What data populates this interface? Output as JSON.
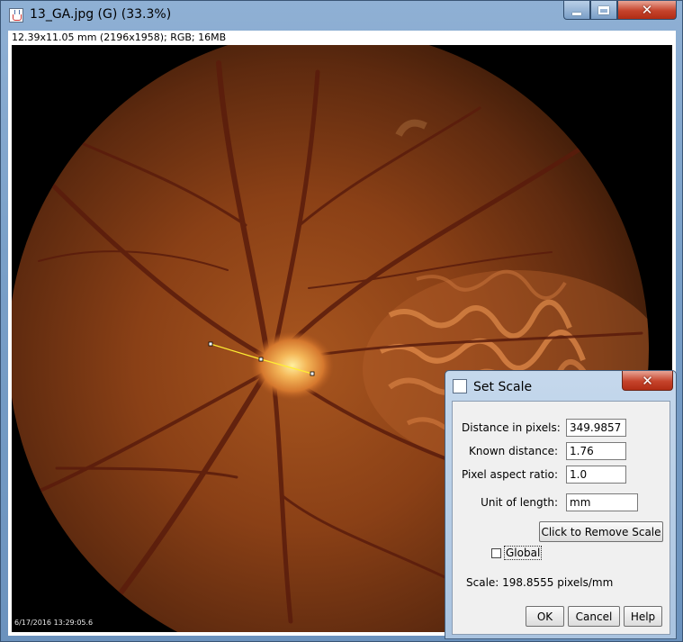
{
  "window": {
    "title": "13_GA.jpg (G) (33.3%)",
    "controls": {
      "minimize": "minimize-icon",
      "maximize": "maximize-icon",
      "close": "close-icon"
    }
  },
  "image": {
    "info": "12.39x11.05 mm (2196x1958); RGB; 16MB",
    "timestamp": "6/17/2016  13:29:05.6"
  },
  "dialog": {
    "title": "Set Scale",
    "fields": [
      {
        "label": "Distance in pixels:",
        "value": "349.9857"
      },
      {
        "label": "Known distance:",
        "value": "1.76"
      },
      {
        "label": "Pixel aspect ratio:",
        "value": "1.0"
      },
      {
        "label": "Unit of length:",
        "value": "mm"
      }
    ],
    "remove_scale_label": "Click to Remove Scale",
    "global_label": "Global",
    "global_checked": false,
    "scale_text": "Scale: 198.8555 pixels/mm",
    "buttons": {
      "ok": "OK",
      "cancel": "Cancel",
      "help": "Help"
    }
  },
  "colors": {
    "measurement_line": "#ffee33",
    "title_bar": "#7aa0c8",
    "close_button": "#c5432b"
  }
}
